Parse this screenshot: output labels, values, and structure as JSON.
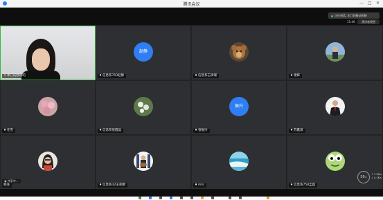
{
  "window": {
    "title": "腾讯会议",
    "minimize": "—",
    "maximize": "□",
    "close": "✕"
  },
  "tooltip": "正在讲话: 木汀的移动的移",
  "clock": "15:46",
  "speaker_view_label": "演讲者视图",
  "tiles": [
    {
      "name": "木汀的移动的",
      "kind": "video"
    },
    {
      "name": "信息系703赵静",
      "kind": "text",
      "avatar_text": "赵静"
    },
    {
      "name": "信息系石祥瑞",
      "kind": "photo",
      "icon": "teddy-bear-avatar-icon"
    },
    {
      "name": "谢辉",
      "kind": "photo",
      "icon": "person-outdoor-avatar-icon"
    },
    {
      "name": "任杰",
      "kind": "photo",
      "icon": "pink-flowers-avatar-icon"
    },
    {
      "name": "信息系张圆晶",
      "kind": "photo",
      "icon": "white-flowers-avatar-icon"
    },
    {
      "name": "张振兴",
      "kind": "text",
      "avatar_text": "振兴"
    },
    {
      "name": "苏鑫源",
      "kind": "photo",
      "icon": "man-suit-avatar-icon"
    },
    {
      "name": "顾兆",
      "kind": "photo",
      "icon": "woman-glasses-avatar-icon"
    },
    {
      "name": "信息系32王莉娜",
      "kind": "photo",
      "icon": "guitar-player-avatar-icon"
    },
    {
      "name": "min",
      "kind": "photo",
      "icon": "seascape-avatar-icon"
    },
    {
      "name": "信息系758孟磊",
      "kind": "photo",
      "icon": "frog-cartoon-avatar-icon"
    }
  ],
  "share_badge": "共享中...",
  "network": {
    "value": "50",
    "unit": "%",
    "up": "↑ 7.5K/s",
    "down": "↓ 4.1K/s"
  },
  "colors": {
    "active_border": "#2fbd3f",
    "avatar_blue": "#2f7ef4",
    "tile_bg": "#2e2f32"
  }
}
